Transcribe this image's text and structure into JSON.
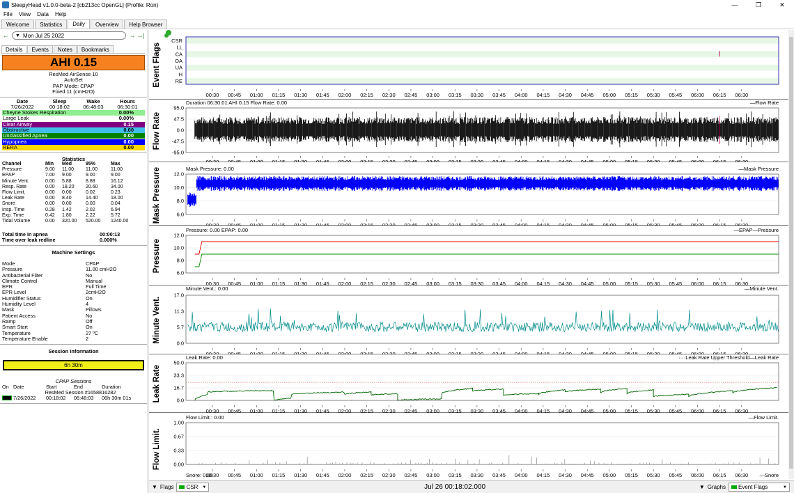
{
  "window": {
    "title": "SleepyHead v1.0.0-beta-2 [cb213cc OpenGL] (Profile: Ron)",
    "minimize": "—",
    "maximize": "❐",
    "close": "✕"
  },
  "menu": [
    "File",
    "View",
    "Data",
    "Help"
  ],
  "tabs": [
    "Welcome",
    "Statistics",
    "Daily",
    "Overview",
    "Help Browser"
  ],
  "active_tab": "Daily",
  "date_nav": {
    "prev": "←",
    "date": "Mon Jul 25 2022",
    "next": "→",
    "last": "→|"
  },
  "left_tabs": [
    "Details",
    "Events",
    "Notes",
    "Bookmarks"
  ],
  "ahi": {
    "text": "AHI 0.15",
    "color": "#f5821f"
  },
  "device": [
    "ResMed AirSense 10",
    "AutoSet",
    "PAP Mode: CPAP",
    "Fixed 11 (cmH2O)"
  ],
  "summary": {
    "headers": [
      "Date",
      "Sleep",
      "Wake",
      "Hours"
    ],
    "values": [
      "7/26/2022",
      "00:18:02",
      "06:48:03",
      "06:30:01"
    ]
  },
  "events": [
    {
      "name": "Cheyne Stokes Respiration",
      "value": "0.00%",
      "bg": "#90ee90",
      "fg": "#000"
    },
    {
      "name": "Large Leak",
      "value": "0.00%",
      "bg": "#ffffff",
      "fg": "#000"
    },
    {
      "name": "Clear Airway",
      "value": "0.15",
      "bg": "#800080",
      "fg": "#ffffff"
    },
    {
      "name": "Obstructive",
      "value": "0.00",
      "bg": "#40c0e8",
      "fg": "#000"
    },
    {
      "name": "Unclassified Apnea",
      "value": "0.00",
      "bg": "#008000",
      "fg": "#ffffff"
    },
    {
      "name": "Hypopnea",
      "value": "0.00",
      "bg": "#0000ff",
      "fg": "#ffffff"
    },
    {
      "name": "RERA",
      "value": "0.00",
      "bg": "#ffd700",
      "fg": "#000"
    }
  ],
  "statistics": {
    "title": "Statistics",
    "headers": [
      "Channel",
      "Min",
      "Med",
      "95%",
      "Max"
    ],
    "rows": [
      [
        "Pressure",
        "9.00",
        "11.00",
        "11.00",
        "11.00"
      ],
      [
        "EPAP",
        "7.00",
        "9.00",
        "9.00",
        "9.00"
      ],
      [
        "Minute Vent.",
        "0.00",
        "5.88",
        "8.88",
        "16.12"
      ],
      [
        "Resp. Rate",
        "0.00",
        "18.20",
        "20.60",
        "34.00"
      ],
      [
        "Flow Limit.",
        "0.00",
        "0.00",
        "0.02",
        "0.23"
      ],
      [
        "Leak Rate",
        "0.00",
        "8.40",
        "14.40",
        "18.00"
      ],
      [
        "Snore",
        "0.00",
        "0.00",
        "0.00",
        "0.04"
      ],
      [
        "Insp. Time",
        "0.28",
        "1.42",
        "2.02",
        "6.94"
      ],
      [
        "Exp. Time",
        "0.42",
        "1.80",
        "2.22",
        "5.72"
      ],
      [
        "Tidal Volume",
        "0.00",
        "320.00",
        "520.00",
        "1240.00"
      ]
    ]
  },
  "apnea": [
    [
      "Total time in apnea",
      "00:00:13"
    ],
    [
      "Time over leak redline",
      "0.000%"
    ]
  ],
  "machine_settings": {
    "title": "Machine Settings",
    "rows": [
      [
        "Mode",
        "CPAP"
      ],
      [
        "Pressure",
        "11.00 cmH2O"
      ],
      [
        "Antibacterial Filter",
        "No"
      ],
      [
        "Climate Control",
        "Manual"
      ],
      [
        "EPR",
        "Full Time"
      ],
      [
        "EPR Level",
        "2cmH2O"
      ],
      [
        "Humidifier Status",
        "On"
      ],
      [
        "Humidity Level",
        "4"
      ],
      [
        "Mask",
        "Pillows"
      ],
      [
        "Patient Access",
        "No"
      ],
      [
        "Ramp",
        "Off"
      ],
      [
        "Smart Start",
        "On"
      ],
      [
        "Temperature",
        "27 ºC"
      ],
      [
        "Temperature Enable",
        "2"
      ]
    ]
  },
  "session_info": {
    "title": "Session Information",
    "bar": "6h 30m",
    "cpap_title": "CPAP Sessions",
    "headers": [
      "On",
      "Date",
      "Start",
      "End",
      "Duration"
    ],
    "session_label": "ResMed Session #1658816282",
    "row": [
      "7/26/2022",
      "00:18:02",
      "06:48:03",
      "06h 30m 01s"
    ]
  },
  "time_ticks": [
    "00:30",
    "00:45",
    "01:00",
    "01:15",
    "01:30",
    "01:45",
    "02:00",
    "02:15",
    "02:30",
    "02:45",
    "03:00",
    "03:15",
    "03:30",
    "03:45",
    "04:00",
    "04:15",
    "04:30",
    "04:45",
    "05:00",
    "05:15",
    "05:30",
    "05:45",
    "06:00",
    "06:15",
    "06:30"
  ],
  "graphs": {
    "event_flags": {
      "title": "Event Flags",
      "rows": [
        "CSR",
        "LL",
        "CA",
        "OA",
        "UA",
        "H",
        "RE"
      ]
    },
    "flow_rate": {
      "title": "Flow Rate",
      "info": "Duration 06:30:01 AHI 0.15 Flow Rate: 0.00",
      "legend": "Flow Rate",
      "yticks": [
        "95.0",
        "47.5",
        "0.0",
        "-47.5",
        "-95.0"
      ],
      "ylim": [
        -95,
        95
      ],
      "color": "#000000"
    },
    "mask_pressure": {
      "title": "Mask Pressure",
      "info": "Mask Pressure: 0.00",
      "legend": "Mask Pressure",
      "yticks": [
        "12.0",
        "10.0",
        "8.0",
        "6.0"
      ],
      "ylim": [
        6,
        12
      ],
      "color": "#0000ff"
    },
    "pressure": {
      "title": "Pressure",
      "info": "Pressure: 0.00 EPAP: 0.00",
      "legend_epap": "EPAP",
      "legend_pressure": "Pressure",
      "yticks": [
        "12.0",
        "10.0",
        "8.0",
        "6.0"
      ],
      "ylim": [
        6,
        12
      ],
      "pressure_color": "#e00000",
      "epap_color": "#009000"
    },
    "minute_vent": {
      "title": "Minute Vent.",
      "info": "Minute Vent.: 0.00",
      "legend": "Minute Vent.",
      "yticks": [
        "17.0",
        "11.3",
        "5.7",
        "0.0"
      ],
      "ylim": [
        0,
        17
      ],
      "color": "#008b8b"
    },
    "leak_rate": {
      "title": "Leak Rate",
      "info": "Leak Rate: 0.00",
      "legend_thresh": "Leak Rate Upper Threshold",
      "legend": "Leak Rate",
      "yticks": [
        "50.0",
        "33.3",
        "16.7",
        "0.0"
      ],
      "ylim": [
        0,
        50
      ],
      "color": "#006400",
      "threshold": 24
    },
    "flow_limit": {
      "title": "Flow Limit.",
      "info": "Flow Limit.: 0.00",
      "legend": "Flow Limit.",
      "yticks": [
        "1.00",
        "0.67",
        "0.33",
        "0.00"
      ],
      "ylim": [
        0,
        1
      ],
      "color": "#999999"
    },
    "snore": {
      "info": "Snore: 0.00",
      "legend": "Snore"
    }
  },
  "bottom": {
    "flags_label": "Flags",
    "csr_label": "CSR",
    "timestamp": "Jul 26 00:18:02.000",
    "graphs_label": "Graphs",
    "event_flags_label": "Event Flags"
  }
}
